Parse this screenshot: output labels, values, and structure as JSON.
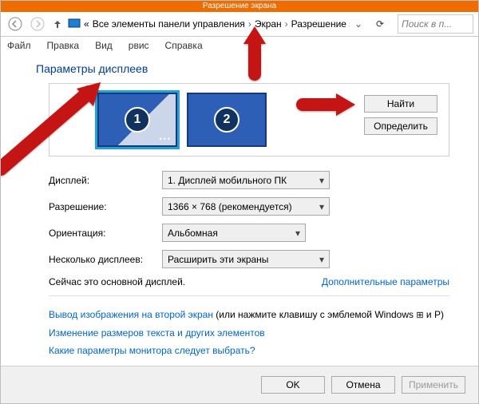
{
  "title": "Разрешение экрана",
  "breadcrumb": {
    "root": "«",
    "items": [
      "Все элементы панели управления",
      "Экран",
      "Разрешение экрана"
    ]
  },
  "search_placeholder": "Поиск в п...",
  "menu": {
    "file": "Файл",
    "edit": "Правка",
    "view": "Вид",
    "service": "рвис",
    "help": "Справка"
  },
  "heading": "Параметры дисплеев",
  "monitors": {
    "n1": "1",
    "n2": "2"
  },
  "side": {
    "find": "Найти",
    "identify": "Определить"
  },
  "fields": {
    "display_label": "Дисплей:",
    "display_value": "1. Дисплей мобильного ПК",
    "resolution_label": "Разрешение:",
    "resolution_value": "1366 × 768 (рекомендуется)",
    "orientation_label": "Ориентация:",
    "orientation_value": "Альбомная",
    "multi_label": "Несколько дисплеев:",
    "multi_value": "Расширить эти экраны"
  },
  "status": "Сейчас это основной дисплей.",
  "adv_link": "Дополнительные параметры",
  "tips": {
    "line1_link": "Вывод изображения на второй экран",
    "line1_rest": " (или нажмите клавишу с эмблемой Windows ",
    "line1_tail": " и P)",
    "line2": "Изменение размеров текста и других элементов",
    "line3": "Какие параметры монитора следует выбрать?"
  },
  "footer": {
    "ok": "OK",
    "cancel": "Отмена",
    "apply": "Применить"
  }
}
